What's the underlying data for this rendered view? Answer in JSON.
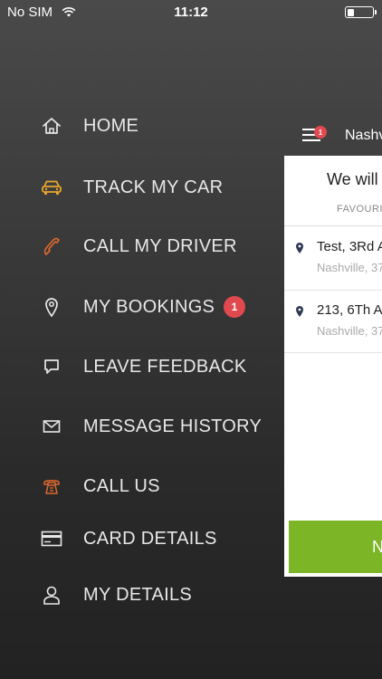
{
  "status_bar": {
    "carrier": "No SIM",
    "time": "11:12",
    "battery_level": 0.2
  },
  "menu": {
    "items": [
      {
        "label": "HOME",
        "icon": "home-icon",
        "color": "#e8e8e8"
      },
      {
        "label": "TRACK MY CAR",
        "icon": "car-icon",
        "color": "#e8a62a"
      },
      {
        "label": "CALL MY DRIVER",
        "icon": "phone-icon",
        "color": "#e06a2e"
      },
      {
        "label": "MY BOOKINGS",
        "icon": "location-pin-icon",
        "color": "#e8e8e8",
        "badge": "1"
      },
      {
        "label": "LEAVE FEEDBACK",
        "icon": "chat-bubble-icon",
        "color": "#e8e8e8"
      },
      {
        "label": "MESSAGE HISTORY",
        "icon": "envelope-icon",
        "color": "#e8e8e8"
      },
      {
        "label": "CALL US",
        "icon": "telephone-icon",
        "color": "#e06a2e"
      },
      {
        "label": "CARD DETAILS",
        "icon": "credit-card-icon",
        "color": "#e8e8e8"
      },
      {
        "label": "MY DETAILS",
        "icon": "user-icon",
        "color": "#e8e8e8"
      }
    ]
  },
  "main": {
    "header_badge": "1",
    "header_city": "Nashv",
    "title": "We will",
    "tab": "FAVOURI",
    "addresses": [
      {
        "line1": "Test, 3Rd A",
        "line2": "Nashville, 37"
      },
      {
        "line1": "213, 6Th A",
        "line2": "Nashville, 37"
      }
    ],
    "button_label": "N",
    "accent_color": "#7cb526",
    "badge_color": "#e04a4f"
  }
}
